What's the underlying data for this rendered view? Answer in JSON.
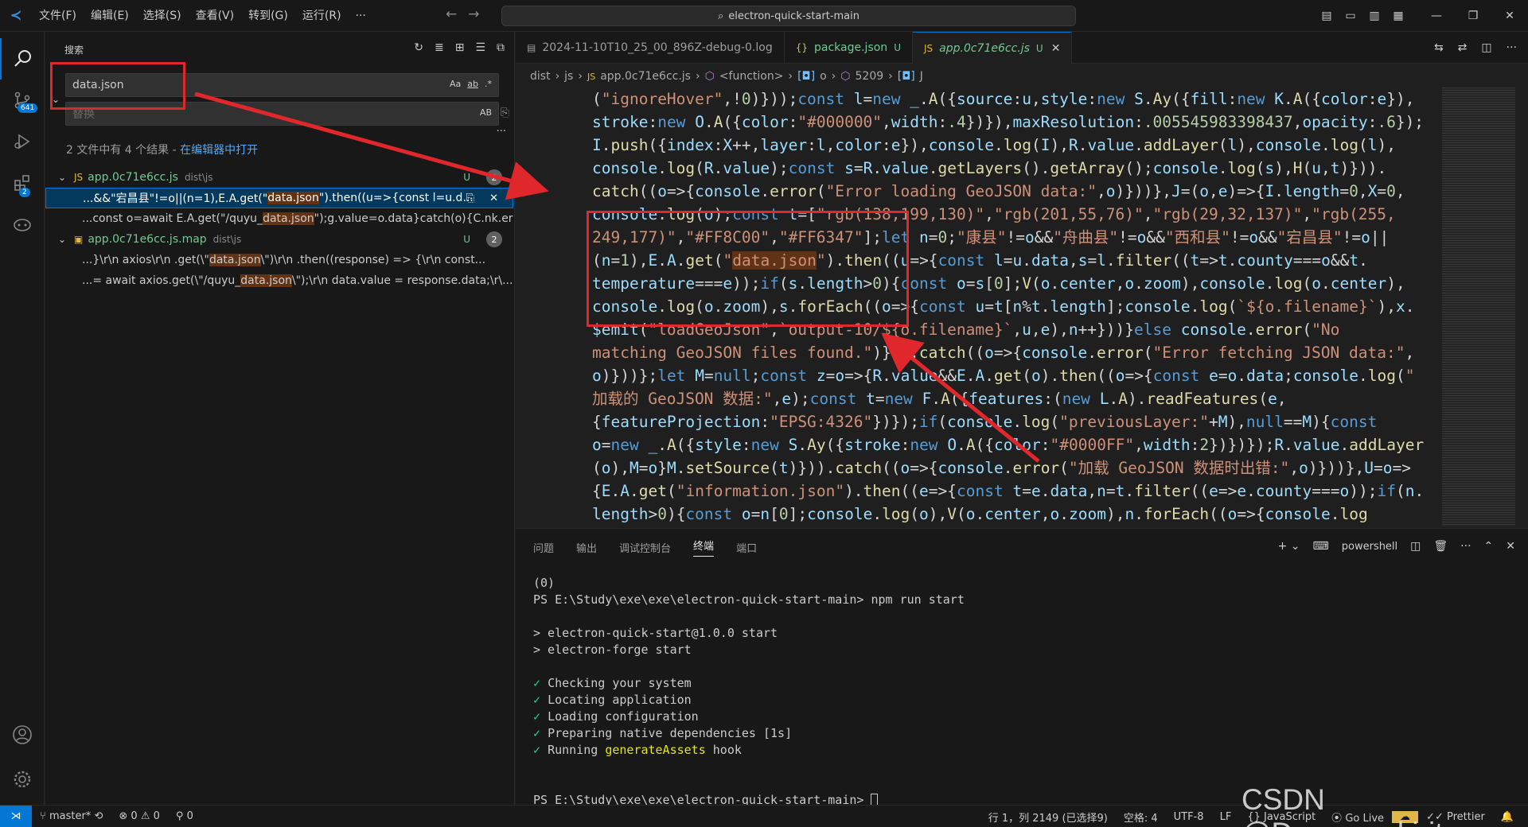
{
  "titlebar": {
    "menus": [
      "文件(F)",
      "编辑(E)",
      "选择(S)",
      "查看(V)",
      "转到(G)",
      "运行(R)",
      "···"
    ],
    "command_center": "electron-quick-start-main"
  },
  "activity": {
    "scm_badge": "641",
    "ext_badge": "2"
  },
  "sidebar": {
    "title": "搜索",
    "search_value": "data.json",
    "search_opts": [
      "Aa",
      "ab",
      ".*"
    ],
    "replace_placeholder": "替换",
    "replace_opt": "AB",
    "summary_text": "2 文件中有 4 个结果 - ",
    "summary_link": "在编辑器中打开",
    "files": [
      {
        "name": "app.0c71e6cc.js",
        "path": "dist\\js",
        "status": "U",
        "count": "2",
        "matches": [
          {
            "pre": "...&&\"宕昌县\"!=o||(n=1),E.A.get(\"",
            "hit": "data.json",
            "post": "\").then((u=>{const l=u.d..."
          },
          {
            "pre": "...const o=await E.A.get(\"/quyu_",
            "hit": "data.json",
            "post": "\");g.value=o.data}catch(o){C.nk.error..."
          }
        ]
      },
      {
        "name": "app.0c71e6cc.js.map",
        "path": "dist\\js",
        "status": "U",
        "count": "2",
        "matches": [
          {
            "pre": "...}\\r\\n  axios\\r\\n    .get(\\\"",
            "hit": "data.json",
            "post": "\\\")\\r\\n    .then((response) => {\\r\\n      const..."
          },
          {
            "pre": "...= await axios.get(\\\"/quyu_",
            "hit": "data.json",
            "post": "\\\");\\r\\n    data.value = response.data;\\r\\..."
          }
        ]
      }
    ]
  },
  "tabs": [
    {
      "label": "2024-11-10T10_25_00_896Z-debug-0.log",
      "icon": "file-icon",
      "status": ""
    },
    {
      "label": "package.json",
      "icon": "braces-icon",
      "status": "U"
    },
    {
      "label": "app.0c71e6cc.js",
      "icon": "js-icon",
      "status": "U"
    }
  ],
  "breadcrumb": [
    "dist",
    "js",
    "app.0c71e6cc.js",
    "<function>",
    "o",
    "5209",
    "J"
  ],
  "panel": {
    "tabs": [
      "问题",
      "输出",
      "调试控制台",
      "终端",
      "端口"
    ],
    "active_tab": "终端",
    "shell": "powershell",
    "terminal_lines": [
      "(0)",
      "PS E:\\Study\\exe\\exe\\electron-quick-start-main> npm run start",
      "",
      "> electron-quick-start@1.0.0 start",
      "> electron-forge start",
      ""
    ],
    "checks": [
      "Checking your system",
      "Locating application",
      "Loading configuration",
      "Preparing native dependencies [1s]"
    ],
    "running_pre": "Running ",
    "running_hl": "generateAssets",
    "running_post": " hook",
    "prompt_final": "PS E:\\Study\\exe\\exe\\electron-quick-start-main> "
  },
  "status": {
    "branch": "master*",
    "errors": "0",
    "warnings": "0",
    "ports": "0",
    "position": "行 1，列 2149 (已选择9)",
    "spaces": "空格: 4",
    "encoding": "UTF-8",
    "eol": "LF",
    "language": "JavaScript",
    "golive": "Go Live",
    "prettier": "Prettier"
  },
  "watermark": "CSDN @Demons_kirit"
}
